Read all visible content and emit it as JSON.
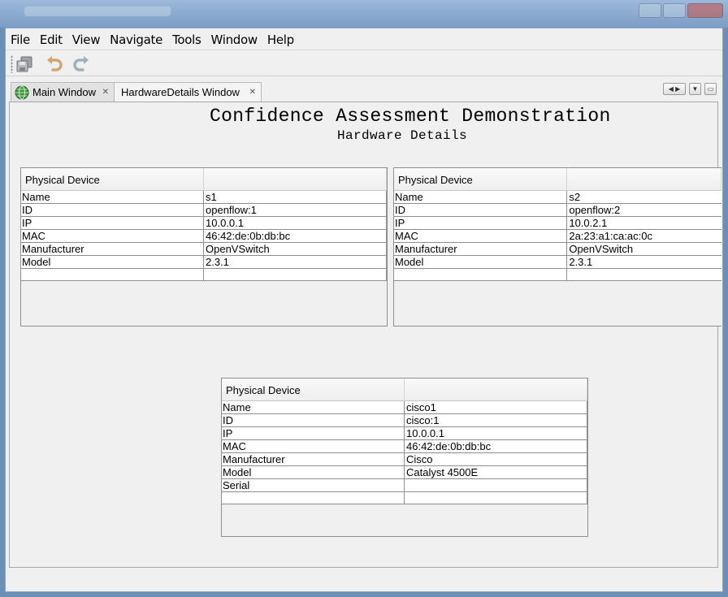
{
  "menubar": {
    "items": [
      "File",
      "Edit",
      "View",
      "Navigate",
      "Tools",
      "Window",
      "Help"
    ]
  },
  "toolbar": {
    "buttons": [
      {
        "icon": "save-all-icon",
        "label": ""
      },
      {
        "icon": "undo-icon",
        "label": ""
      },
      {
        "icon": "redo-icon",
        "label": ""
      }
    ]
  },
  "tabs": [
    {
      "label": "Main Window",
      "icon": "globe-icon",
      "active": false
    },
    {
      "label": "HardwareDetails Window",
      "active": true
    }
  ],
  "page": {
    "title": "Confidence Assessment Demonstration",
    "subtitle": "Hardware Details"
  },
  "devices": [
    {
      "header": "Physical Device",
      "rows": [
        {
          "key": "Name",
          "value": "s1"
        },
        {
          "key": "ID",
          "value": "openflow:1"
        },
        {
          "key": "IP",
          "value": "10.0.0.1"
        },
        {
          "key": "MAC",
          "value": "46:42:de:0b:db:bc"
        },
        {
          "key": "Manufacturer",
          "value": "OpenVSwitch"
        },
        {
          "key": "Model",
          "value": "2.3.1"
        }
      ]
    },
    {
      "header": "Physical Device",
      "rows": [
        {
          "key": "Name",
          "value": "s2"
        },
        {
          "key": "ID",
          "value": "openflow:2"
        },
        {
          "key": "IP",
          "value": "10.0.2.1"
        },
        {
          "key": "MAC",
          "value": "2a:23:a1:ca:ac:0c"
        },
        {
          "key": "Manufacturer",
          "value": "OpenVSwitch"
        },
        {
          "key": "Model",
          "value": "2.3.1"
        }
      ]
    },
    {
      "header": "Physical Device",
      "rows": [
        {
          "key": "Name",
          "value": "cisco1"
        },
        {
          "key": "ID",
          "value": "cisco:1"
        },
        {
          "key": "IP",
          "value": "10.0.0.1"
        },
        {
          "key": "MAC",
          "value": "46:42:de:0b:db:bc"
        },
        {
          "key": "Manufacturer",
          "value": "Cisco"
        },
        {
          "key": "Model",
          "value": "Catalyst 4500E"
        },
        {
          "key": "Serial",
          "value": ""
        }
      ]
    }
  ]
}
